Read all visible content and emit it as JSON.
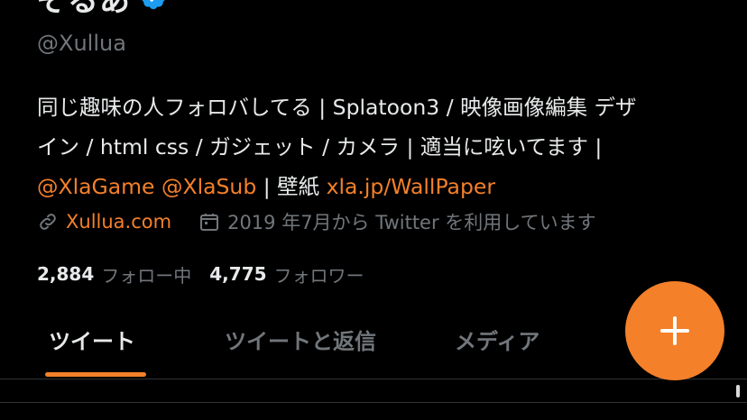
{
  "profile": {
    "display_name": "そるあ",
    "handle": "@Xullua",
    "bio": {
      "line1": "同じ趣味の人フォロバしてる | Splatoon3 / 映像画像編集 デザ",
      "line2": "イン / html css / ガジェット / カメラ | 適当に呟いてます |",
      "mention1": "@XlaGame",
      "mention2": "@XlaSub",
      "wallpaper_label": " | 壁紙 ",
      "wallpaper_link": "xla.jp/WallPaper"
    },
    "website": "Xullua.com",
    "joined": "2019 年7月から Twitter を利用しています",
    "following_count": "2,884",
    "following_label": "フォロー中",
    "followers_count": "4,775",
    "followers_label": "フォロワー"
  },
  "tabs": [
    {
      "label": "ツイート",
      "active": true
    },
    {
      "label": "ツイートと返信",
      "active": false
    },
    {
      "label": "メディア",
      "active": false
    }
  ],
  "colors": {
    "accent": "#f4802a",
    "verified": "#1d9bf0",
    "muted": "#71767b"
  },
  "icons": {
    "verified": "verified-badge-icon",
    "link": "link-icon",
    "calendar": "calendar-icon",
    "compose": "plus-icon"
  }
}
